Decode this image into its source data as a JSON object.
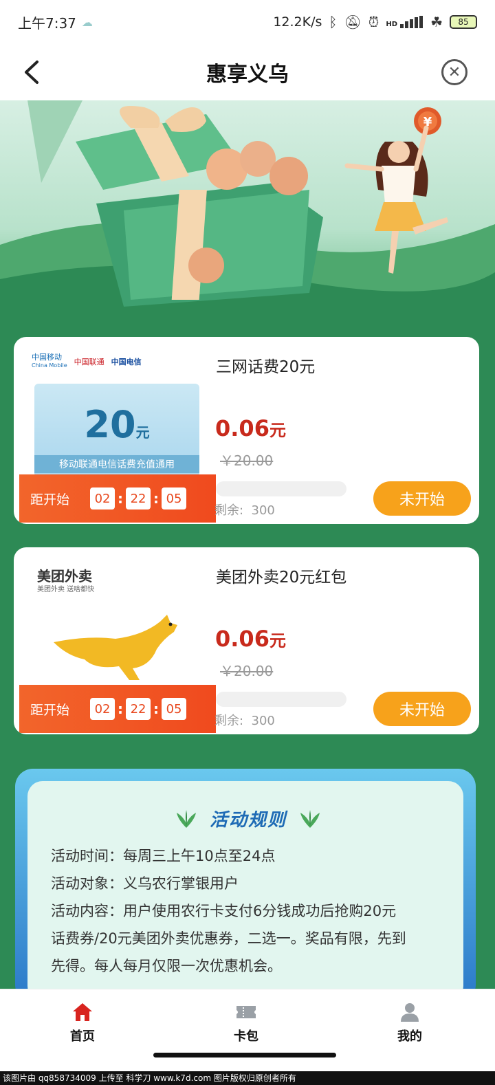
{
  "status_bar": {
    "time": "上午7:37",
    "network_speed": "12.2K/s",
    "hd_label": "HD",
    "battery": "85",
    "icons": [
      "cloud-icon",
      "bluetooth-icon",
      "mute-icon",
      "alarm-icon",
      "signal-icon",
      "clover-icon",
      "battery-icon"
    ]
  },
  "nav": {
    "title": "惠享义乌",
    "back_icon": "chevron-left-icon",
    "close_icon": "close-circle-icon"
  },
  "hero": {
    "coin_symbol": "¥"
  },
  "products": [
    {
      "name": "三网话费20元",
      "price": "0.06",
      "price_unit": "元",
      "original_price": "￥20.00",
      "stock_label": "剩余:",
      "stock": "300",
      "button": "未开始",
      "countdown_label": "距开始",
      "countdown": [
        "02",
        "22",
        "05"
      ],
      "image": {
        "carriers": [
          "中国移动",
          "China Mobile",
          "中国联通",
          "中国电信"
        ],
        "amount": "20",
        "unit": "元",
        "caption": "移动联通电信话费充值通用"
      }
    },
    {
      "name": "美团外卖20元红包",
      "price": "0.06",
      "price_unit": "元",
      "original_price": "￥20.00",
      "stock_label": "剩余:",
      "stock": "300",
      "button": "未开始",
      "countdown_label": "距开始",
      "countdown": [
        "02",
        "22",
        "05"
      ],
      "image": {
        "brand": "美团外卖",
        "slogan": "美团外卖 送啥都快"
      }
    }
  ],
  "rules": {
    "title": "活动规则",
    "lines": [
      "活动时间：每周三上午10点至24点",
      "活动对象：义乌农行掌银用户",
      "活动内容：用户使用农行卡支付6分钱成功后抢购20元",
      "话费券/20元美团外卖优惠券，二选一。奖品有限，先到",
      "先得。每人每月仅限一次优惠机会。"
    ]
  },
  "tabs": [
    {
      "label": "首页",
      "icon": "home-icon",
      "active": true
    },
    {
      "label": "卡包",
      "icon": "ticket-icon",
      "active": false
    },
    {
      "label": "我的",
      "icon": "user-icon",
      "active": false
    }
  ],
  "watermark": "该图片由 qq858734009 上传至 科学刀 www.k7d.com 图片版权归原创者所有",
  "colors": {
    "accent_green": "#2d8a55",
    "price_red": "#c82a1c",
    "button_orange": "#f7a21b",
    "countdown_red": "#f04a1e",
    "home_red": "#d8241f"
  }
}
